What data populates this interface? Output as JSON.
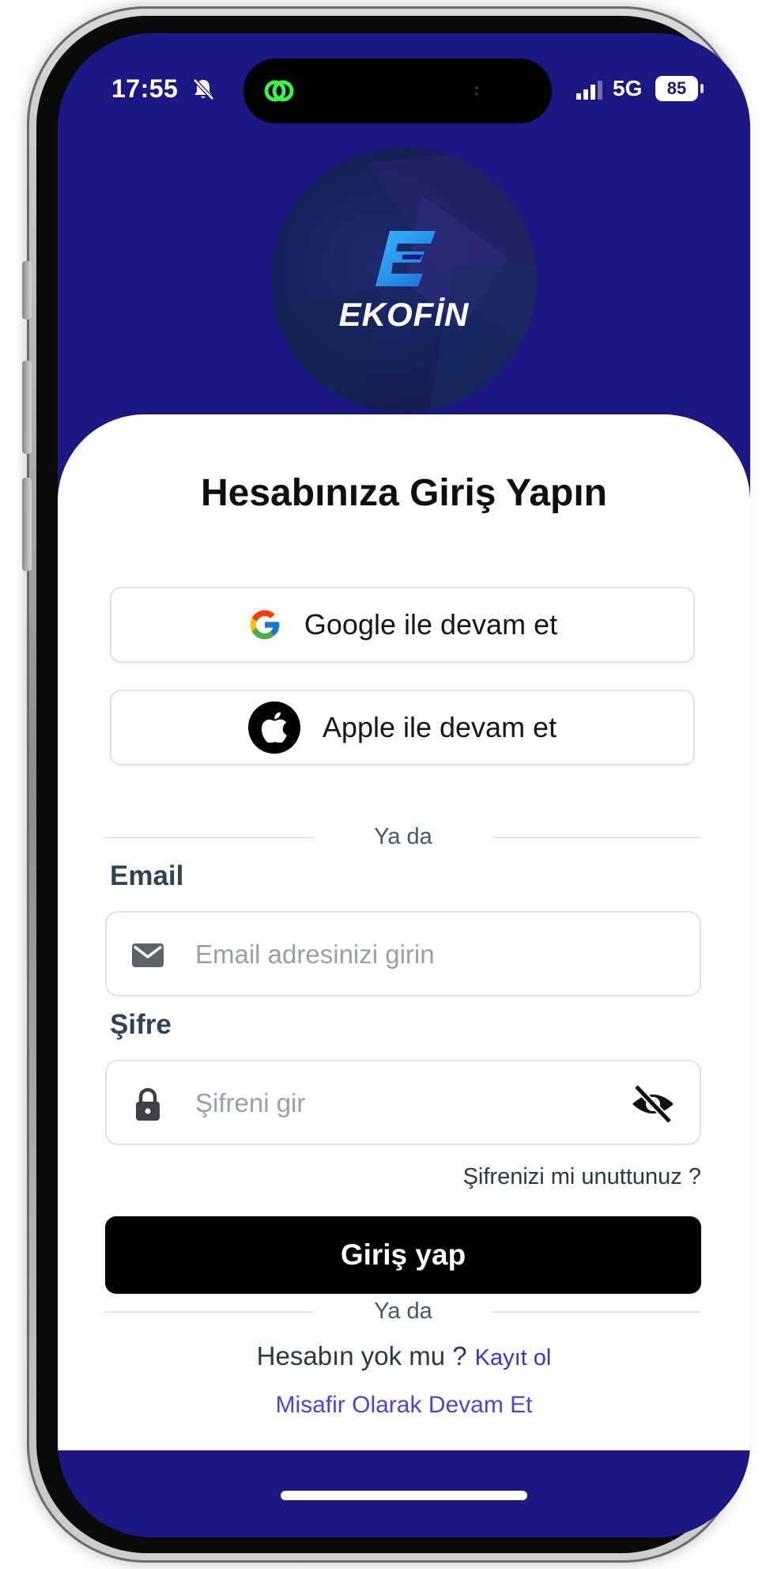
{
  "status_bar": {
    "time": "17:55",
    "network": "5G",
    "battery": "85"
  },
  "brand": {
    "name": "EKOFİN",
    "colors": {
      "hero_background": "#1b1883",
      "accent_link": "#3b32d6",
      "primary_button": "#000000"
    }
  },
  "login": {
    "title": "Hesabınıza Giriş Yapın",
    "google_label": "Google ile devam et",
    "apple_label": "Apple ile devam et",
    "divider_text": "Ya da",
    "email_label": "Email",
    "email_placeholder": "Email adresinizi girin",
    "email_value": "",
    "password_label": "Şifre",
    "password_placeholder": "Şifreni gir",
    "password_value": "",
    "forgot_password": "Şifrenizi mi unuttunuz ?",
    "submit_label": "Giriş yap",
    "divider_text_2": "Ya da",
    "no_account_text": "Hesabın yok mu ?",
    "signup_link": "Kayıt ol",
    "guest_link": "Misafir Olarak Devam Et"
  },
  "icons": {
    "google": "google-icon",
    "apple": "apple-icon",
    "email": "envelope-icon",
    "password": "lock-icon",
    "visibility": "eye-slash-icon",
    "notifications": "bell-slash-icon",
    "island": "link-icon"
  }
}
